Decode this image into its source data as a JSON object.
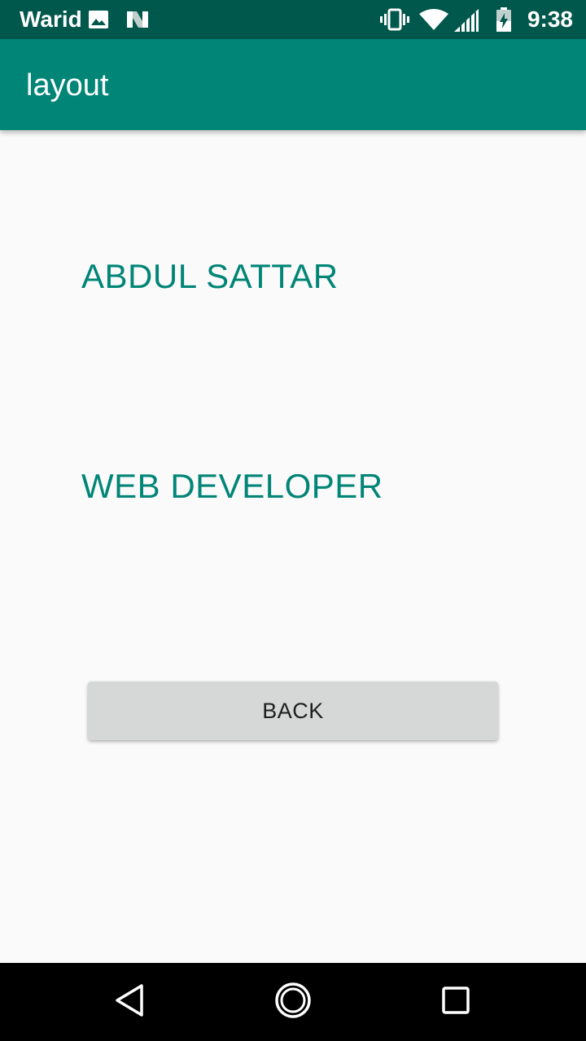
{
  "status_bar": {
    "carrier": "Warid",
    "time": "9:38",
    "icons": [
      "image-icon",
      "n-logo-icon",
      "vibrate-icon",
      "wifi-icon",
      "signal-icon",
      "battery-charging-icon"
    ]
  },
  "app_bar": {
    "title": "layout",
    "color": "#008577"
  },
  "content": {
    "name": "ABDUL SATTAR",
    "role": "WEB DEVELOPER",
    "text_color": "#008577"
  },
  "actions": {
    "back_label": "BACK"
  },
  "nav_bar": {
    "icons": [
      "back-triangle-icon",
      "home-circle-icon",
      "recents-square-icon"
    ]
  }
}
